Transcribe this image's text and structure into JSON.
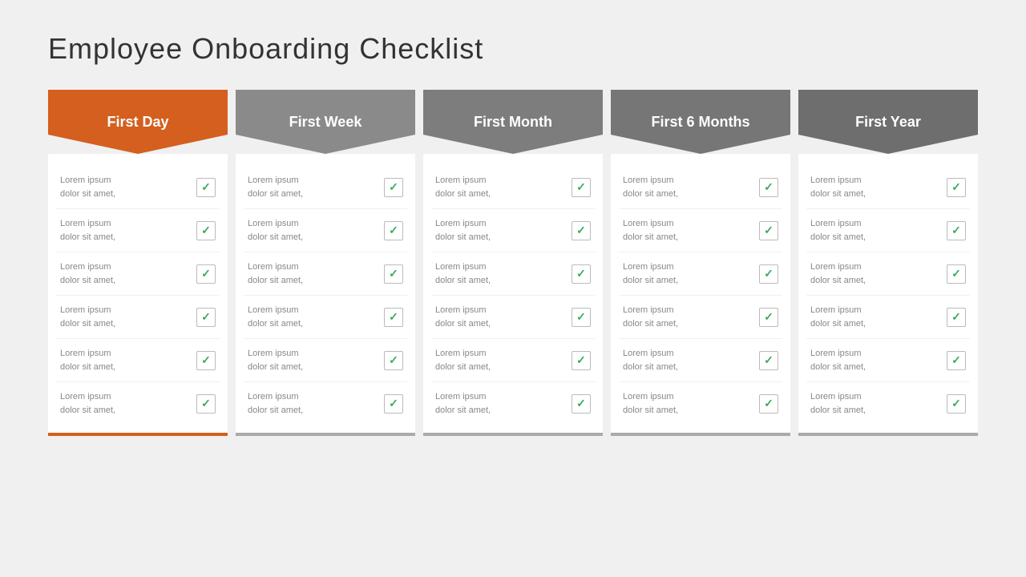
{
  "title": "Employee  Onboarding Checklist",
  "columns": [
    {
      "id": "first-day",
      "label": "First Day",
      "headerColor": "orange",
      "bodyBorder": "orange-border",
      "items": [
        {
          "text": "Lorem ipsum\ndolor sit amet,"
        },
        {
          "text": "Lorem ipsum\ndolor sit amet,"
        },
        {
          "text": "Lorem ipsum\ndolor sit amet,"
        },
        {
          "text": "Lorem ipsum\ndolor sit amet,"
        },
        {
          "text": "Lorem ipsum\ndolor sit amet,"
        },
        {
          "text": "Lorem ipsum\ndolor sit amet,"
        }
      ]
    },
    {
      "id": "first-week",
      "label": "First Week",
      "headerColor": "gray1",
      "bodyBorder": "gray-border",
      "items": [
        {
          "text": "Lorem ipsum\ndolor sit amet,"
        },
        {
          "text": "Lorem ipsum\ndolor sit amet,"
        },
        {
          "text": "Lorem ipsum\ndolor sit amet,"
        },
        {
          "text": "Lorem ipsum\ndolor sit amet,"
        },
        {
          "text": "Lorem ipsum\ndolor sit amet,"
        },
        {
          "text": "Lorem ipsum\ndolor sit amet,"
        }
      ]
    },
    {
      "id": "first-month",
      "label": "First Month",
      "headerColor": "gray2",
      "bodyBorder": "gray-border",
      "items": [
        {
          "text": "Lorem ipsum\ndolor sit amet,"
        },
        {
          "text": "Lorem ipsum\ndolor sit amet,"
        },
        {
          "text": "Lorem ipsum\ndolor sit amet,"
        },
        {
          "text": "Lorem ipsum\ndolor sit amet,"
        },
        {
          "text": "Lorem ipsum\ndolor sit amet,"
        },
        {
          "text": "Lorem ipsum\ndolor sit amet,"
        }
      ]
    },
    {
      "id": "first-6-months",
      "label": "First 6 Months",
      "headerColor": "gray3",
      "bodyBorder": "gray-border",
      "items": [
        {
          "text": "Lorem ipsum\ndolor sit amet,"
        },
        {
          "text": "Lorem ipsum\ndolor sit amet,"
        },
        {
          "text": "Lorem ipsum\ndolor sit amet,"
        },
        {
          "text": "Lorem ipsum\ndolor sit amet,"
        },
        {
          "text": "Lorem ipsum\ndolor sit amet,"
        },
        {
          "text": "Lorem ipsum\ndolor sit amet,"
        }
      ]
    },
    {
      "id": "first-year",
      "label": "First Year",
      "headerColor": "gray4",
      "bodyBorder": "gray-border",
      "items": [
        {
          "text": "Lorem ipsum\ndolor sit amet,"
        },
        {
          "text": "Lorem ipsum\ndolor sit amet,"
        },
        {
          "text": "Lorem ipsum\ndolor sit amet,"
        },
        {
          "text": "Lorem ipsum\ndolor sit amet,"
        },
        {
          "text": "Lorem ipsum\ndolor sit amet,"
        },
        {
          "text": "Lorem ipsum\ndolor sit amet,"
        }
      ]
    }
  ],
  "checkmark": "✓"
}
